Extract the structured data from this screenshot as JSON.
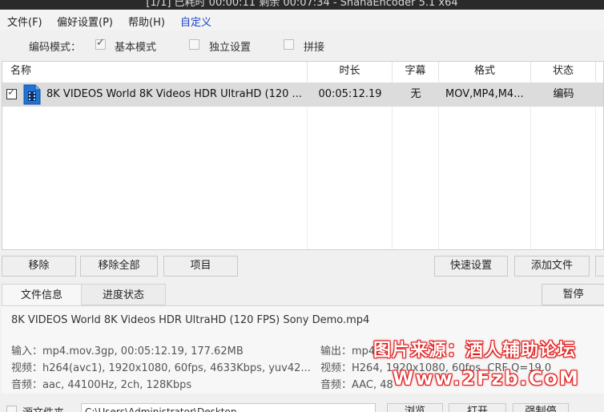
{
  "window": {
    "title": "[1/1] 已耗时 00:00:11  剩余 00:07:34 - ShanaEncoder 5.1 x64"
  },
  "menu": {
    "file": "文件(F)",
    "prefs": "偏好设置(P)",
    "help": "帮助(H)",
    "custom": "自定义"
  },
  "mode": {
    "label": "编码模式：",
    "basic": {
      "label": "基本模式",
      "checked": true
    },
    "independent": {
      "label": "独立设置",
      "checked": false
    },
    "concat": {
      "label": "拼接",
      "checked": false
    }
  },
  "list": {
    "columns": [
      "名称",
      "时长",
      "字幕",
      "格式",
      "状态"
    ],
    "rows": [
      {
        "checked": true,
        "icon": "video-file-icon",
        "name": "8K VIDEOS   World 8K Videos HDR UltraHD  (120 ...",
        "duration": "00:05:12.19",
        "subtitle": "无",
        "format": "MOV,MP4,M4...",
        "status": "编码"
      }
    ]
  },
  "buttons": {
    "remove": "移除",
    "remove_all": "移除全部",
    "item": "项目",
    "quick": "快速设置",
    "add_file": "添加文件",
    "pause": "暂停",
    "browse": "浏览",
    "open": "打开",
    "force": "强制停"
  },
  "tabs": {
    "file_info": "文件信息",
    "progress": "进度状态"
  },
  "info": {
    "filename": "8K VIDEOS   World 8K Videos HDR UltraHD  (120 FPS)   Sony Demo.mp4",
    "input": "输入：mp4.mov.3gp, 00:05:12.19, 177.62MB",
    "input_video": "视频：h264(avc1), 1920x1080, 60fps, 4633Kbps,  yuv42...",
    "input_audio": "音频：aac, 44100Hz, 2ch, 128Kbps",
    "output": "输出：mp4",
    "output_video": "视频：H264, 1920x1080, 60fps, CRF Q=19.0",
    "output_audio": "音频：AAC, 48"
  },
  "source": {
    "label": "源文件夹",
    "path": "C:\\Users\\Administrator\\Desktop"
  },
  "watermark": {
    "line1": "图片来源：酒人辅助论坛",
    "line2": "Www.2Fzb.CoM"
  }
}
